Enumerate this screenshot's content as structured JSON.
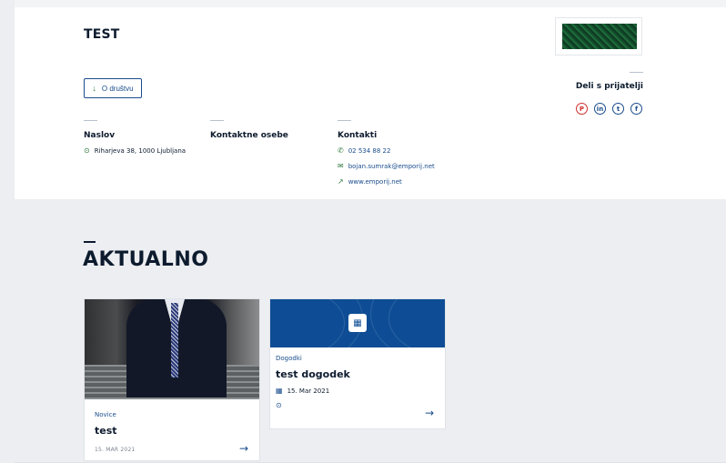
{
  "company": {
    "name": "TEST"
  },
  "about_button": {
    "label": "O društvu",
    "icon": "arrow-down-icon"
  },
  "share": {
    "title": "Deli s prijatelji",
    "networks": [
      {
        "name": "pinterest",
        "glyph": "P",
        "color": "#d0312d"
      },
      {
        "name": "linkedin",
        "glyph": "in",
        "color": "#1a4d8c"
      },
      {
        "name": "twitter",
        "glyph": "t",
        "color": "#1a4d8c"
      },
      {
        "name": "facebook",
        "glyph": "f",
        "color": "#1a4d8c"
      }
    ]
  },
  "sections": {
    "address": {
      "title": "Naslov",
      "value": "Riharjeva 38, 1000 Ljubljana"
    },
    "contacts_people": {
      "title": "Kontaktne osebe"
    },
    "contacts": {
      "title": "Kontakti",
      "phone": "02 534 88 22",
      "email": "bojan.sumrak@emporij.net",
      "web": "www.emporij.net"
    }
  },
  "news": {
    "title": "AKTUALNO",
    "cards": [
      {
        "category": "Novice",
        "title": "test",
        "date": "15. MAR 2021"
      },
      {
        "category": "Dogodki",
        "title": "test dogodek",
        "date": "15. Mar 2021"
      }
    ]
  },
  "colors": {
    "accent": "#1a4d8c",
    "banner": "#0e4d95",
    "dark": "#0d1b2e",
    "green": "#2f7a3e"
  }
}
